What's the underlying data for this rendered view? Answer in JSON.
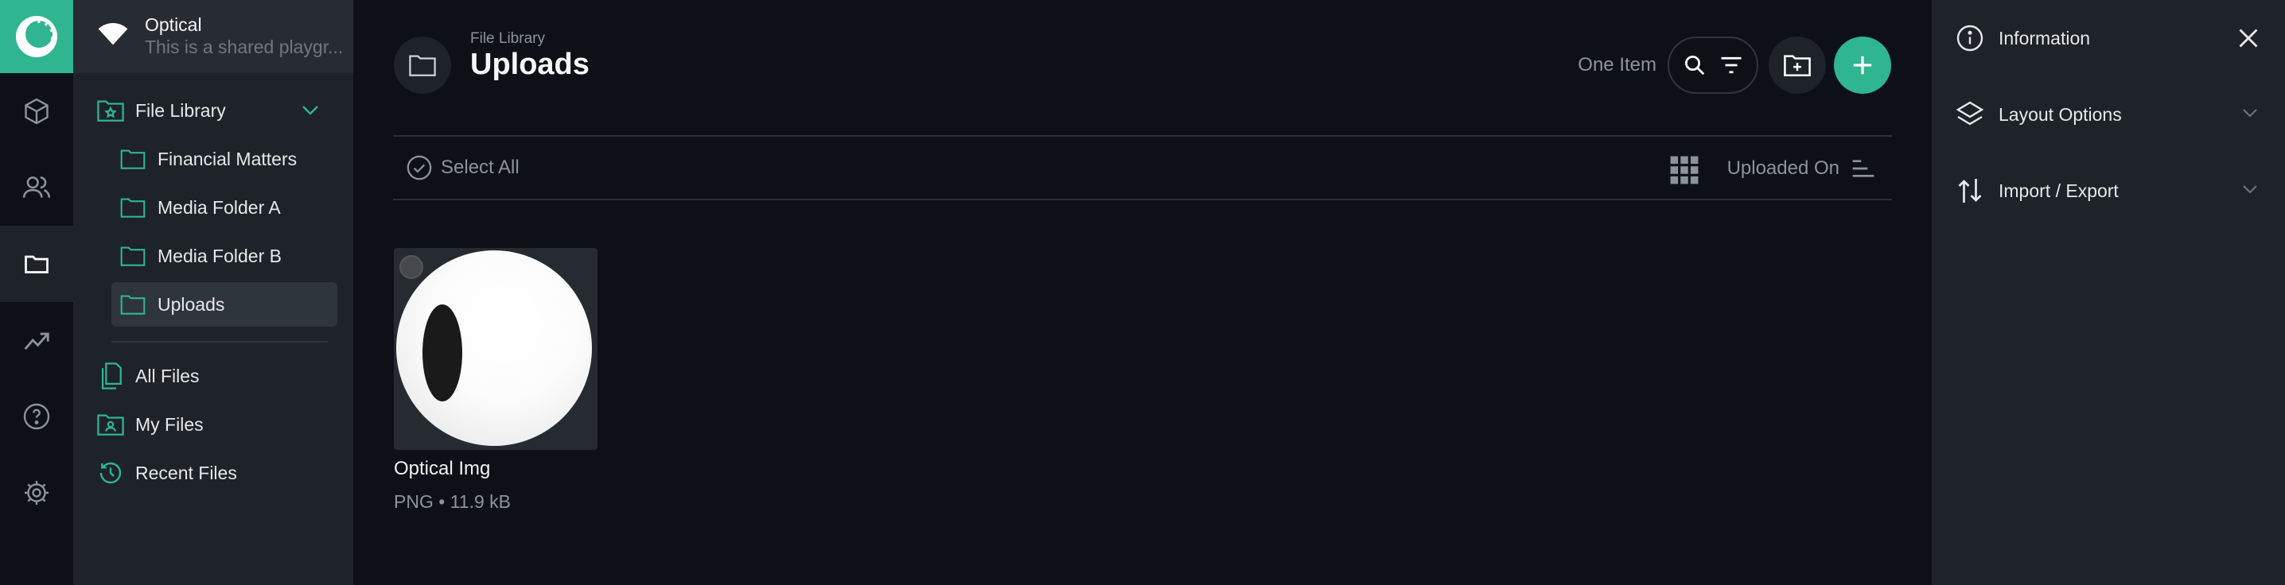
{
  "project": {
    "name": "Optical",
    "description": "This is a shared playgr..."
  },
  "module_bar": {
    "items": [
      {
        "icon": "box-icon"
      },
      {
        "icon": "users-icon"
      },
      {
        "icon": "folder-icon",
        "active": true
      },
      {
        "icon": "insights-icon"
      },
      {
        "icon": "help-icon"
      },
      {
        "icon": "settings-icon"
      }
    ]
  },
  "nav": {
    "file_library": "File Library",
    "folders": [
      "Financial Matters",
      "Media Folder A",
      "Media Folder B",
      "Uploads"
    ],
    "selected_folder": "Uploads",
    "links": [
      "All Files",
      "My Files",
      "Recent Files"
    ]
  },
  "header": {
    "breadcrumb": "File Library",
    "title": "Uploads",
    "item_count": "One Item"
  },
  "toolbar": {
    "select_all": "Select All",
    "sort_field": "Uploaded On"
  },
  "files": [
    {
      "name": "Optical Img",
      "type": "PNG",
      "separator": "•",
      "size": "11.9 kB"
    }
  ],
  "sidebar": {
    "sections": [
      "Information",
      "Layout Options",
      "Import / Export"
    ]
  },
  "colors": {
    "accent": "#2fb590",
    "background": "#0d1117",
    "panel": "#1e2329"
  }
}
